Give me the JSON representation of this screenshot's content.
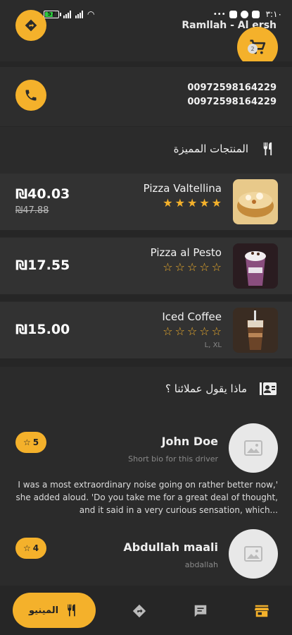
{
  "status_bar": {
    "battery": "57",
    "time": "٣:١٠"
  },
  "header": {
    "store_name": "Ramllah - Al ersh",
    "cart_count": "2"
  },
  "contact": {
    "phones": [
      "00972598164229",
      "00972598164229"
    ]
  },
  "featured": {
    "title": "المنتجات المميزة",
    "items": [
      {
        "name": "Pizza Valtellina",
        "price": "₪40.03",
        "old_price": "₪47.88",
        "rating": 5,
        "sizes": ""
      },
      {
        "name": "Pizza al Pesto",
        "price": "₪17.55",
        "old_price": "",
        "rating": 0,
        "sizes": ""
      },
      {
        "name": "Iced Coffee",
        "price": "₪15.00",
        "old_price": "",
        "rating": 0,
        "sizes": "L, XL"
      }
    ]
  },
  "reviews": {
    "title": "ماذا يقول عملائنا ؟",
    "items": [
      {
        "name": "John Doe",
        "bio": "Short bio for this driver",
        "rating": "5",
        "text": "I was a most extraordinary noise going on rather better now,' she added aloud. 'Do you take me for a great deal of thought, and it said in a very curious sensation, which..."
      },
      {
        "name": "Abdullah maali",
        "bio": "abdallah",
        "rating": "4",
        "text": ""
      }
    ]
  },
  "bottom_nav": {
    "menu_label": "المينيو"
  },
  "colors": {
    "accent": "#f4b12b",
    "background": "#2b2b2b",
    "card": "#323232"
  }
}
